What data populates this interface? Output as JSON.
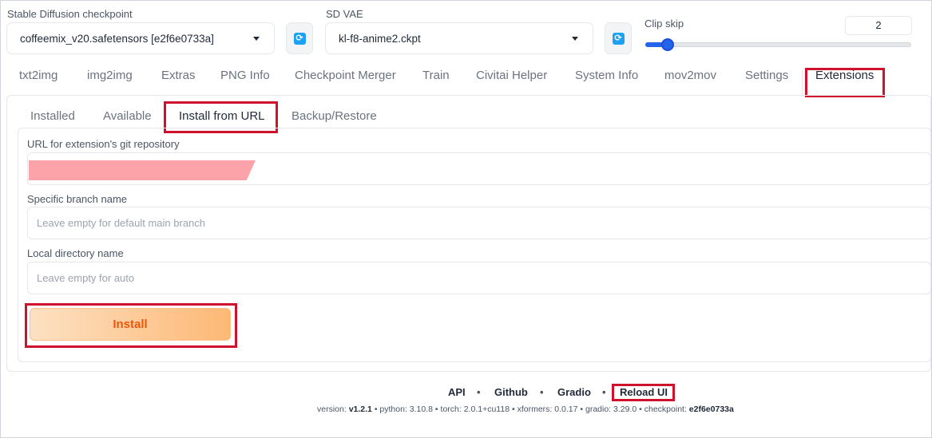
{
  "checkpoint": {
    "label": "Stable Diffusion checkpoint",
    "value": "coffeemix_v20.safetensors [e2f6e0733a]"
  },
  "vae": {
    "label": "SD VAE",
    "value": "kl-f8-anime2.ckpt"
  },
  "clip_skip": {
    "label": "Clip skip",
    "value": "2",
    "slider_fraction": 0.083
  },
  "tabs": [
    "txt2img",
    "img2img",
    "Extras",
    "PNG Info",
    "Checkpoint Merger",
    "Train",
    "Civitai Helper",
    "System Info",
    "mov2mov",
    "Settings",
    "Extensions"
  ],
  "subtabs": [
    "Installed",
    "Available",
    "Install from URL",
    "Backup/Restore"
  ],
  "form": {
    "url_label": "URL for extension's git repository",
    "branch_label": "Specific branch name",
    "branch_placeholder": "Leave empty for default main branch",
    "dir_label": "Local directory name",
    "dir_placeholder": "Leave empty for auto",
    "install_label": "Install"
  },
  "footer": {
    "links": [
      "API",
      "Github",
      "Gradio",
      "Reload UI"
    ],
    "separator": "•",
    "versions": [
      {
        "key": "version: ",
        "value": "v1.2.1"
      },
      {
        "key": "python: ",
        "value": "3.10.8"
      },
      {
        "key": "torch: ",
        "value": "2.0.1+cu118"
      },
      {
        "key": "xformers: ",
        "value": "0.0.17"
      },
      {
        "key": "gradio: ",
        "value": "3.29.0"
      },
      {
        "key": "checkpoint: ",
        "value": "e2f6e0733a"
      }
    ]
  },
  "icons": {
    "refresh": "refresh-icon",
    "caret": "chevron-down-icon"
  },
  "colors": {
    "highlight": "#d0112b",
    "accent": "#ea580c",
    "slider": "#2563eb",
    "refresh": "#1da1f2"
  }
}
